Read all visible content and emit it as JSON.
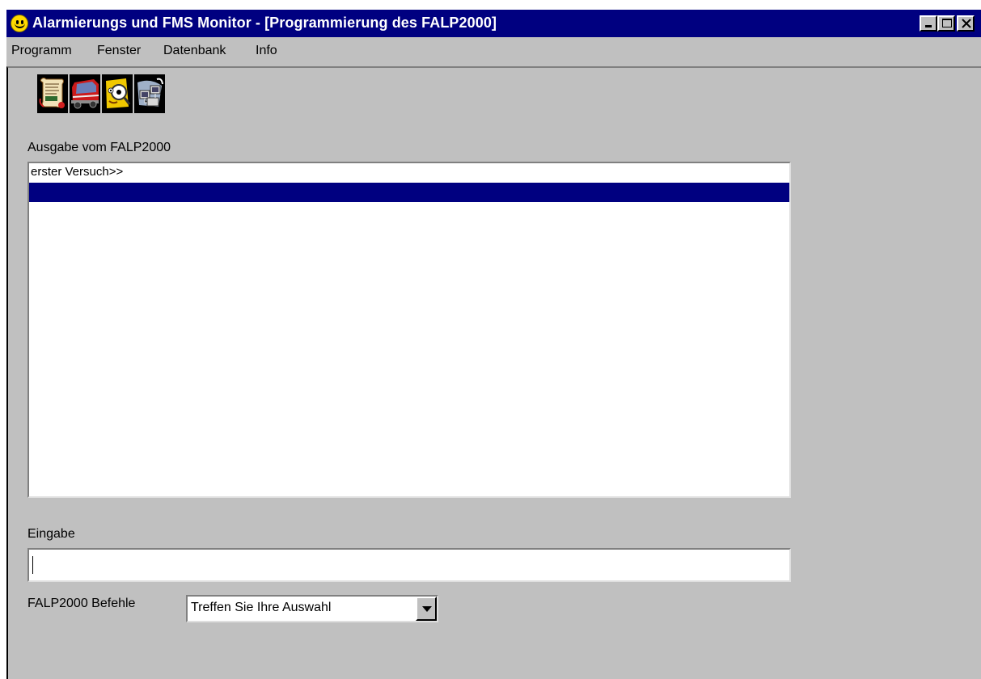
{
  "window": {
    "title": "Alarmierungs und FMS Monitor - [Programmierung des FALP2000]",
    "icon": "smiley-icon"
  },
  "menu": {
    "items": [
      "Programm",
      "Fenster",
      "Datenbank",
      "Info"
    ]
  },
  "toolbar": {
    "buttons": [
      {
        "icon": "document-scroll-icon"
      },
      {
        "icon": "fire-truck-icon"
      },
      {
        "icon": "magnifier-face-icon"
      },
      {
        "icon": "network-computer-icon"
      }
    ]
  },
  "output": {
    "label": "Ausgabe vom FALP2000",
    "lines": [
      "erster Versuch>>",
      ""
    ],
    "selected_index": 1
  },
  "input": {
    "label": "Eingabe",
    "value": ""
  },
  "commands": {
    "label": "FALP2000 Befehle",
    "selected": "Treffen Sie Ihre Auswahl"
  },
  "colors": {
    "titlebar": "#000080",
    "face": "#c0c0c0",
    "selection": "#000080"
  }
}
